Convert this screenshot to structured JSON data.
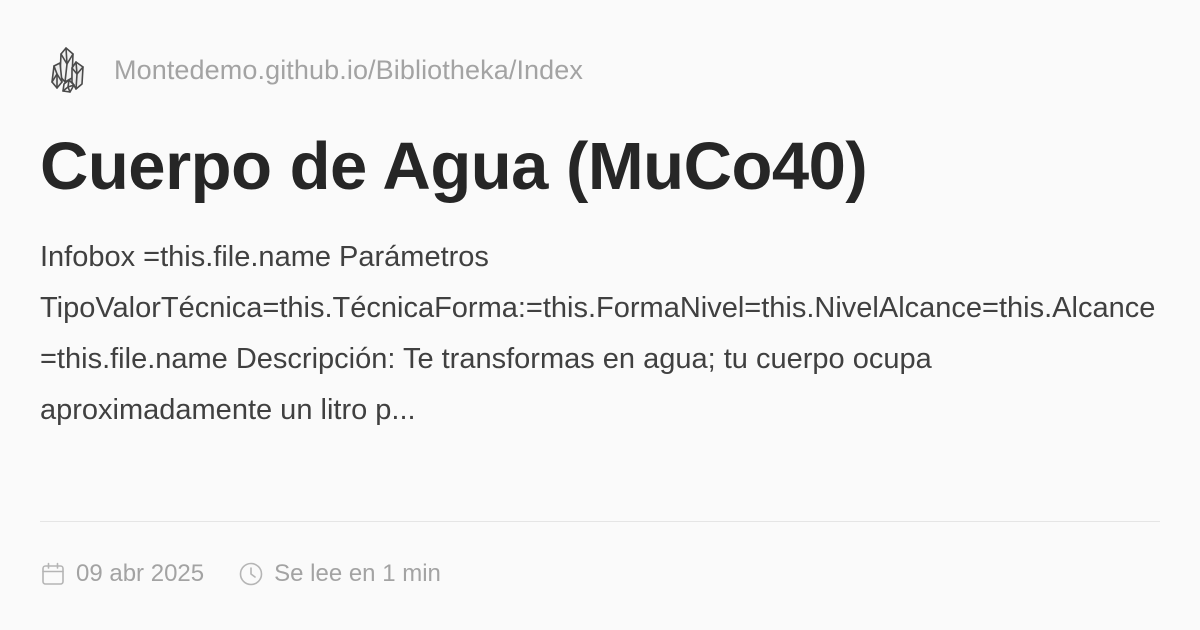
{
  "site": {
    "url": "Montedemo.github.io/Bibliotheka/Index",
    "logo_icon": "crystal-cluster-icon"
  },
  "article": {
    "title": "Cuerpo de Agua (MuCo40)",
    "excerpt_lines": [
      "Infobox =this.file.name Parámetros",
      "TipoValorTécnica=this.TécnicaForma:=this.FormaNivel=this.NivelAlcance=this.Alcance",
      "=this.file.name Descripción: Te transformas en agua; tu cuerpo ocupa",
      "aproximadamente un litro p..."
    ]
  },
  "meta": {
    "date": "09 abr 2025",
    "date_icon": "calendar-icon",
    "reading_time": "Se lee en 1 min",
    "reading_icon": "clock-icon"
  },
  "colors": {
    "background": "#fafafa",
    "title": "#262626",
    "body_text": "#404040",
    "muted": "#a3a3a3",
    "divider": "#e5e5e5"
  }
}
